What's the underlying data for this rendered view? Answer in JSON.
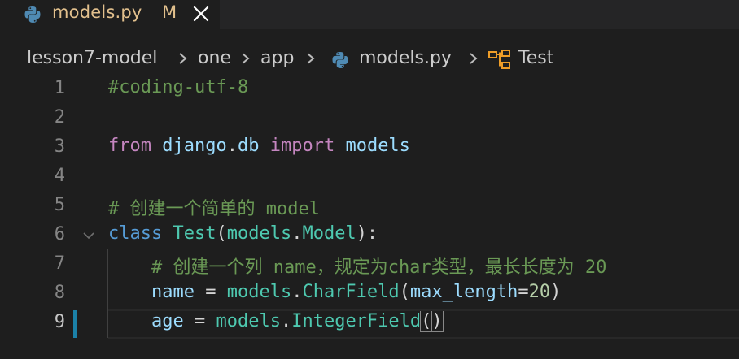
{
  "tab": {
    "filename": "models.py",
    "status": "M",
    "file_icon": "python-icon",
    "close_icon": "close-icon"
  },
  "breadcrumb": {
    "items": [
      "lesson7-model",
      "one",
      "app",
      "models.py",
      "Test"
    ],
    "separator_icon": "chevron-right-icon",
    "symbol_icon": "class-symbol-icon"
  },
  "editor": {
    "active_line": 9,
    "lines": [
      {
        "num": "1",
        "text": "#coding-utf-8"
      },
      {
        "num": "2",
        "text": ""
      },
      {
        "num": "3",
        "text": "from django.db import models"
      },
      {
        "num": "4",
        "text": ""
      },
      {
        "num": "5",
        "text": "# 创建一个简单的 model"
      },
      {
        "num": "6",
        "text": "class Test(models.Model):"
      },
      {
        "num": "7",
        "text": "    # 创建一个列 name，规定为char类型，最长长度为 20"
      },
      {
        "num": "8",
        "text": "    name = models.CharField(max_length=20)"
      },
      {
        "num": "9",
        "text": "    age = models.IntegerField()"
      }
    ]
  },
  "colors": {
    "background": "#1e1e1e",
    "modified": "#e2c08d",
    "keyword": "#c586c0",
    "storage": "#569cd6",
    "class": "#4ec9b0",
    "variable": "#9cdcfe",
    "number": "#b5cea8",
    "comment": "#6a9955"
  }
}
